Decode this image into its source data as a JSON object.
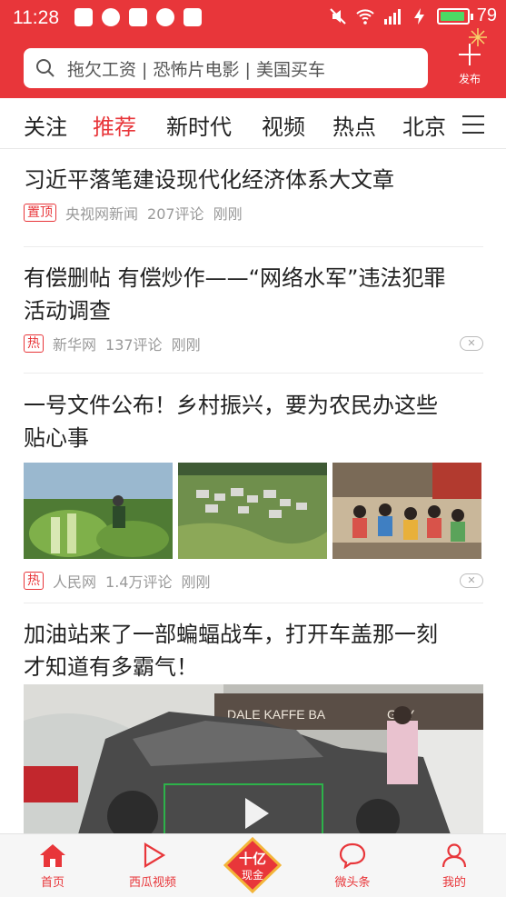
{
  "status": {
    "time": "11:28",
    "battery": "79",
    "network": "4G"
  },
  "search": {
    "placeholder": "拖欠工资 | 恐怖片电影 | 美国买车"
  },
  "publish": {
    "label": "发布"
  },
  "tabs": [
    {
      "label": "关注",
      "active": false
    },
    {
      "label": "推荐",
      "active": true
    },
    {
      "label": "新时代",
      "active": false
    },
    {
      "label": "视频",
      "active": false
    },
    {
      "label": "热点",
      "active": false
    },
    {
      "label": "北京",
      "active": false
    }
  ],
  "feed": [
    {
      "title": "习近平落笔建设现代化经济体系大文章",
      "badge": "置顶",
      "source": "央视网新闻",
      "comments": "207评论",
      "time": "刚刚"
    },
    {
      "title_line1": "有偿删帖 有偿炒作——“网络水军”违法犯罪",
      "title_line2": "活动调查",
      "badge": "热",
      "source": "新华网",
      "comments": "137评论",
      "time": "刚刚"
    },
    {
      "title_line1": "一号文件公布！乡村振兴，要为农民办这些",
      "title_line2": "贴心事",
      "badge": "热",
      "source": "人民网",
      "comments": "1.4万评论",
      "time": "刚刚"
    },
    {
      "title_line1": "加油站来了一部蝙蝠战车，打开车盖那一刻",
      "title_line2": "才知道有多霸气！",
      "sign1": "DALE KAFFE BA",
      "sign2": "GUY"
    }
  ],
  "bottom_nav": [
    {
      "label": "首页"
    },
    {
      "label": "西瓜视频"
    },
    {
      "label": "十亿",
      "sub": "现金"
    },
    {
      "label": "微头条"
    },
    {
      "label": "我的"
    }
  ],
  "colors": {
    "brand_red": "#e8363a",
    "play_outline": "#2db24a"
  }
}
